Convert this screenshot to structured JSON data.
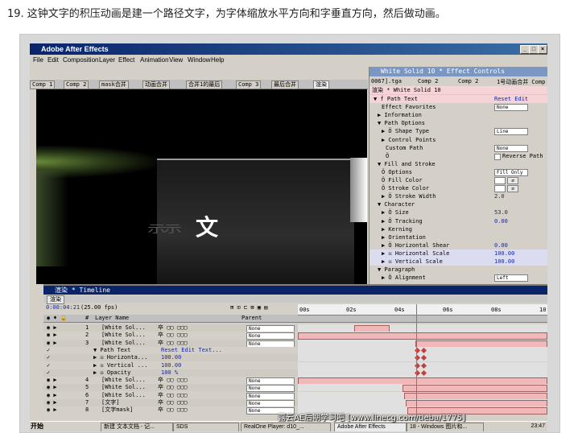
{
  "caption": "19. 这钟文字的积压动画是建一个路径文字，为字体缩放水平方向和字垂直方向，然后做动画。",
  "window": {
    "title": "Adobe After Effects"
  },
  "menu": [
    "File",
    "Edit",
    "Composition",
    "Layer",
    "Effect",
    "Animation",
    "View",
    "Window",
    "Help"
  ],
  "comp_tabs": [
    "Comp 1",
    "Comp 2",
    "mask合并",
    "动画合并",
    "合并1的最后",
    "Comp 3",
    "最后合并",
    "渲染"
  ],
  "viewer": {
    "text": "文",
    "blurred_text": "示示"
  },
  "effect_controls": {
    "title": "White Solid 10 * Effect Controls",
    "tabs": [
      "0067].tga",
      "Comp 2",
      "Comp 2",
      "1号动画合并 Comp"
    ],
    "subtitle": "渲染 * White Solid 10",
    "rows": [
      {
        "label": "▼ f  Path Text",
        "indent": 1,
        "value": "Reset  Edit Text...",
        "kind": "text",
        "pink": true
      },
      {
        "label": "Effect Favorites",
        "indent": 3,
        "value": "None",
        "kind": "dropdown"
      },
      {
        "label": "▶ Information",
        "indent": 2,
        "value": "",
        "kind": "none"
      },
      {
        "label": "▼ Path Options",
        "indent": 2,
        "value": "",
        "kind": "none"
      },
      {
        "label": "▶ Ö Shape Type",
        "indent": 3,
        "value": "Line",
        "kind": "dropdown"
      },
      {
        "label": "▶ Control Points",
        "indent": 3,
        "value": "",
        "kind": "none"
      },
      {
        "label": "Custom Path",
        "indent": 4,
        "value": "None",
        "kind": "dropdown"
      },
      {
        "label": "Ö",
        "indent": 4,
        "value": "Reverse Path",
        "kind": "check"
      },
      {
        "label": "▼ Fill and Stroke",
        "indent": 2,
        "value": "",
        "kind": "none"
      },
      {
        "label": "Ö Options",
        "indent": 3,
        "value": "Fill Only",
        "kind": "dropdown"
      },
      {
        "label": "Ö Fill Color",
        "indent": 3,
        "value": "",
        "kind": "swatch"
      },
      {
        "label": "Ö Stroke Color",
        "indent": 3,
        "value": "",
        "kind": "swatch"
      },
      {
        "label": "▶ Ö Stroke Width",
        "indent": 3,
        "value": "2.0",
        "kind": "text"
      },
      {
        "label": "▼ Character",
        "indent": 2,
        "value": "",
        "kind": "none"
      },
      {
        "label": "▶ Ö Size",
        "indent": 3,
        "value": "53.0",
        "kind": "text"
      },
      {
        "label": "▶ Ö Tracking",
        "indent": 3,
        "value": "0.00",
        "kind": "text"
      },
      {
        "label": "▶ Kerning",
        "indent": 3,
        "value": "",
        "kind": "none"
      },
      {
        "label": "▶ Orientation",
        "indent": 3,
        "value": "",
        "kind": "none"
      },
      {
        "label": "▶ Ö Horizontal Shear",
        "indent": 3,
        "value": "0.00",
        "kind": "text"
      },
      {
        "label": "▶ ☒ Horizontal Scale",
        "indent": 3,
        "value": "100.00",
        "kind": "text",
        "hl": true
      },
      {
        "label": "▶ ☒ Vertical Scale",
        "indent": 3,
        "value": "100.00",
        "kind": "text",
        "hl": true
      },
      {
        "label": "▼ Paragraph",
        "indent": 2,
        "value": "",
        "kind": "none"
      },
      {
        "label": "▶ Ö Alignment",
        "indent": 3,
        "value": "Left",
        "kind": "dropdown"
      }
    ]
  },
  "timeline": {
    "title": "渲染 * Timeline",
    "tab": "渲染",
    "timecode": "0:00:04:21",
    "fps": "(25.00 fps)",
    "col_layer": "Layer Name",
    "col_num": "#",
    "col_parent": "Parent",
    "ruler": [
      "00s",
      "02s",
      "04s",
      "06s",
      "08s",
      "10"
    ],
    "rows": [
      {
        "num": "1",
        "name": "[White Sol...",
        "parent": "None"
      },
      {
        "num": "2",
        "name": "[White Sol...",
        "parent": "None"
      },
      {
        "num": "3",
        "name": "[White Sol...",
        "parent": "None"
      },
      {
        "num": "",
        "name": "▼ Path Text",
        "parent": "",
        "value": "Reset  Edit Text..."
      },
      {
        "num": "",
        "name": "▶ ☒ Horizonta...",
        "parent": "",
        "value": "100.00"
      },
      {
        "num": "",
        "name": "▶ ☒ Vertical ...",
        "parent": "",
        "value": "100.00"
      },
      {
        "num": "",
        "name": "▶ ☒ Opacity",
        "parent": "",
        "value": "100 %"
      },
      {
        "num": "4",
        "name": "[White Sol...",
        "parent": "None"
      },
      {
        "num": "5",
        "name": "[White Sol...",
        "parent": "None"
      },
      {
        "num": "6",
        "name": "[White Sol...",
        "parent": "None"
      },
      {
        "num": "7",
        "name": "[文字]",
        "parent": "None"
      },
      {
        "num": "8",
        "name": "[文字mask]",
        "parent": "None"
      }
    ]
  },
  "taskbar": {
    "start": "开始",
    "items": [
      "新建 文本文档 - 记...",
      "SDS",
      "RealOne Player: d10_...",
      "Adobe After Effects",
      "18 - Windows 图片和..."
    ],
    "clock": "23:47"
  },
  "watermark": "露云AE后期学习吧 [www.linecg.com/tieba/1775]"
}
